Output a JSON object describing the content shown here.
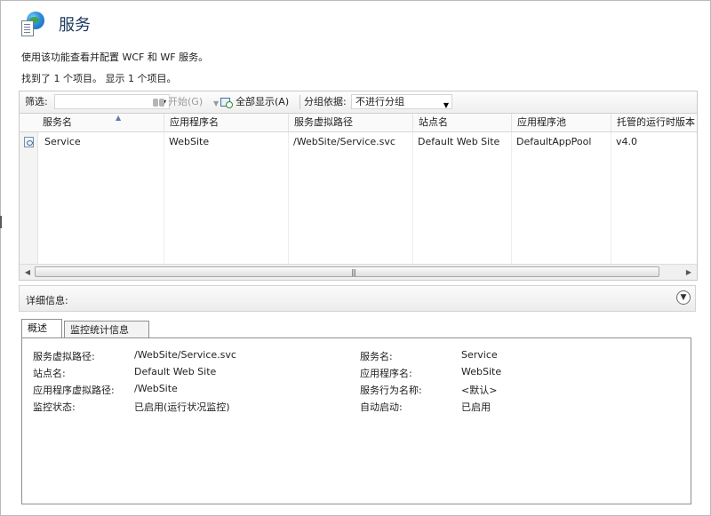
{
  "header": {
    "title": "服务",
    "icon": "globe-document-icon"
  },
  "description": "使用该功能查看并配置 WCF 和 WF 服务。",
  "found_text": "找到了 1 个项目。 显示 1 个项目。",
  "toolbar": {
    "filter_label": "筛选:",
    "start_label": "开始(G)",
    "show_all_label": "全部显示(A)",
    "group_by_label": "分组依据:",
    "group_by_value": "不进行分组"
  },
  "grid": {
    "columns": [
      "服务名",
      "应用程序名",
      "服务虚拟路径",
      "站点名",
      "应用程序池",
      "托管的运行时版本"
    ],
    "rows": [
      {
        "service": "Service",
        "app": "WebSite",
        "path": "/WebSite/Service.svc",
        "site": "Default Web Site",
        "pool": "DefaultAppPool",
        "runtime": "v4.0"
      }
    ]
  },
  "details": {
    "label": "详细信息:",
    "tabs": [
      "概述",
      "监控统计信息"
    ],
    "left": [
      {
        "key": "服务虚拟路径:",
        "value": "/WebSite/Service.svc"
      },
      {
        "key": "站点名:",
        "value": "Default Web Site"
      },
      {
        "key": "应用程序虚拟路径:",
        "value": "/WebSite"
      },
      {
        "key": "监控状态:",
        "value": "已启用(运行状况监控)"
      }
    ],
    "right": [
      {
        "key": "服务名:",
        "value": "Service"
      },
      {
        "key": "应用程序名:",
        "value": "WebSite"
      },
      {
        "key": "服务行为名称:",
        "value": "<默认>"
      },
      {
        "key": "自动启动:",
        "value": "已启用"
      }
    ]
  },
  "colors": {
    "title": "#1e3a5f",
    "border": "#c9c9c9",
    "toolbar_bg": "#efefef"
  }
}
